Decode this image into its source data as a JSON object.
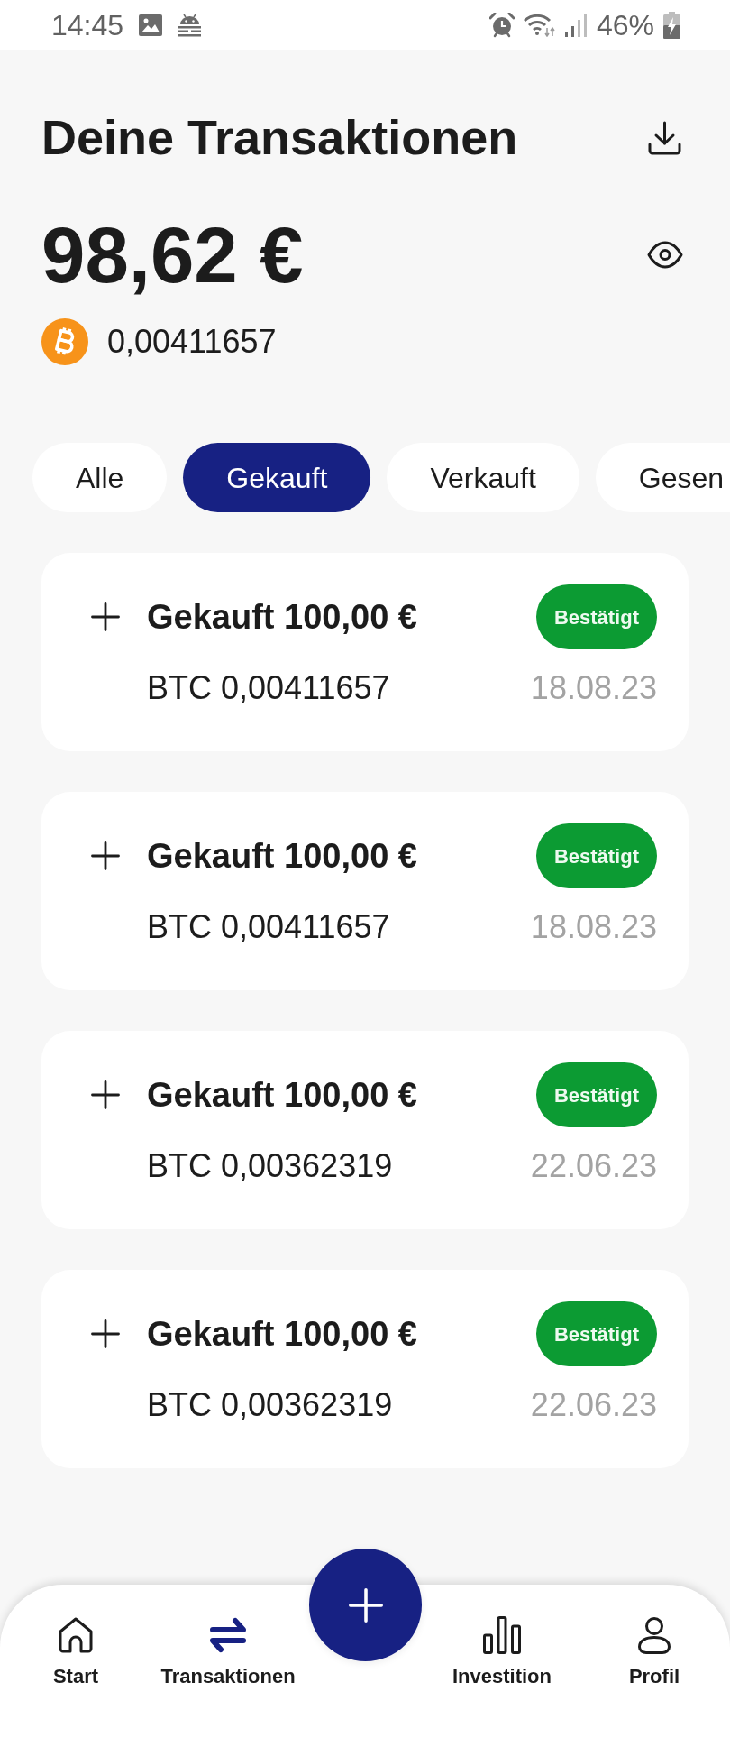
{
  "status_bar": {
    "time": "14:45",
    "battery": "46%"
  },
  "header": {
    "title": "Deine Transaktionen"
  },
  "balance": {
    "amount": "98,62 €",
    "btc_amount": "0,00411657"
  },
  "filters": [
    {
      "label": "Alle",
      "selected": false
    },
    {
      "label": "Gekauft",
      "selected": true
    },
    {
      "label": "Verkauft",
      "selected": false
    },
    {
      "label": "Gesen",
      "selected": false
    }
  ],
  "transactions": [
    {
      "title": "Gekauft 100,00 €",
      "amount": "BTC 0,00411657",
      "status": "Bestätigt",
      "date": "18.08.23"
    },
    {
      "title": "Gekauft 100,00 €",
      "amount": "BTC 0,00411657",
      "status": "Bestätigt",
      "date": "18.08.23"
    },
    {
      "title": "Gekauft 100,00 €",
      "amount": "BTC 0,00362319",
      "status": "Bestätigt",
      "date": "22.06.23"
    },
    {
      "title": "Gekauft 100,00 €",
      "amount": "BTC 0,00362319",
      "status": "Bestätigt",
      "date": "22.06.23"
    }
  ],
  "bottom_nav": [
    {
      "label": "Start",
      "selected": false
    },
    {
      "label": "Transaktionen",
      "selected": true
    },
    {
      "label": "Investition",
      "selected": false
    },
    {
      "label": "Profil",
      "selected": false
    }
  ]
}
